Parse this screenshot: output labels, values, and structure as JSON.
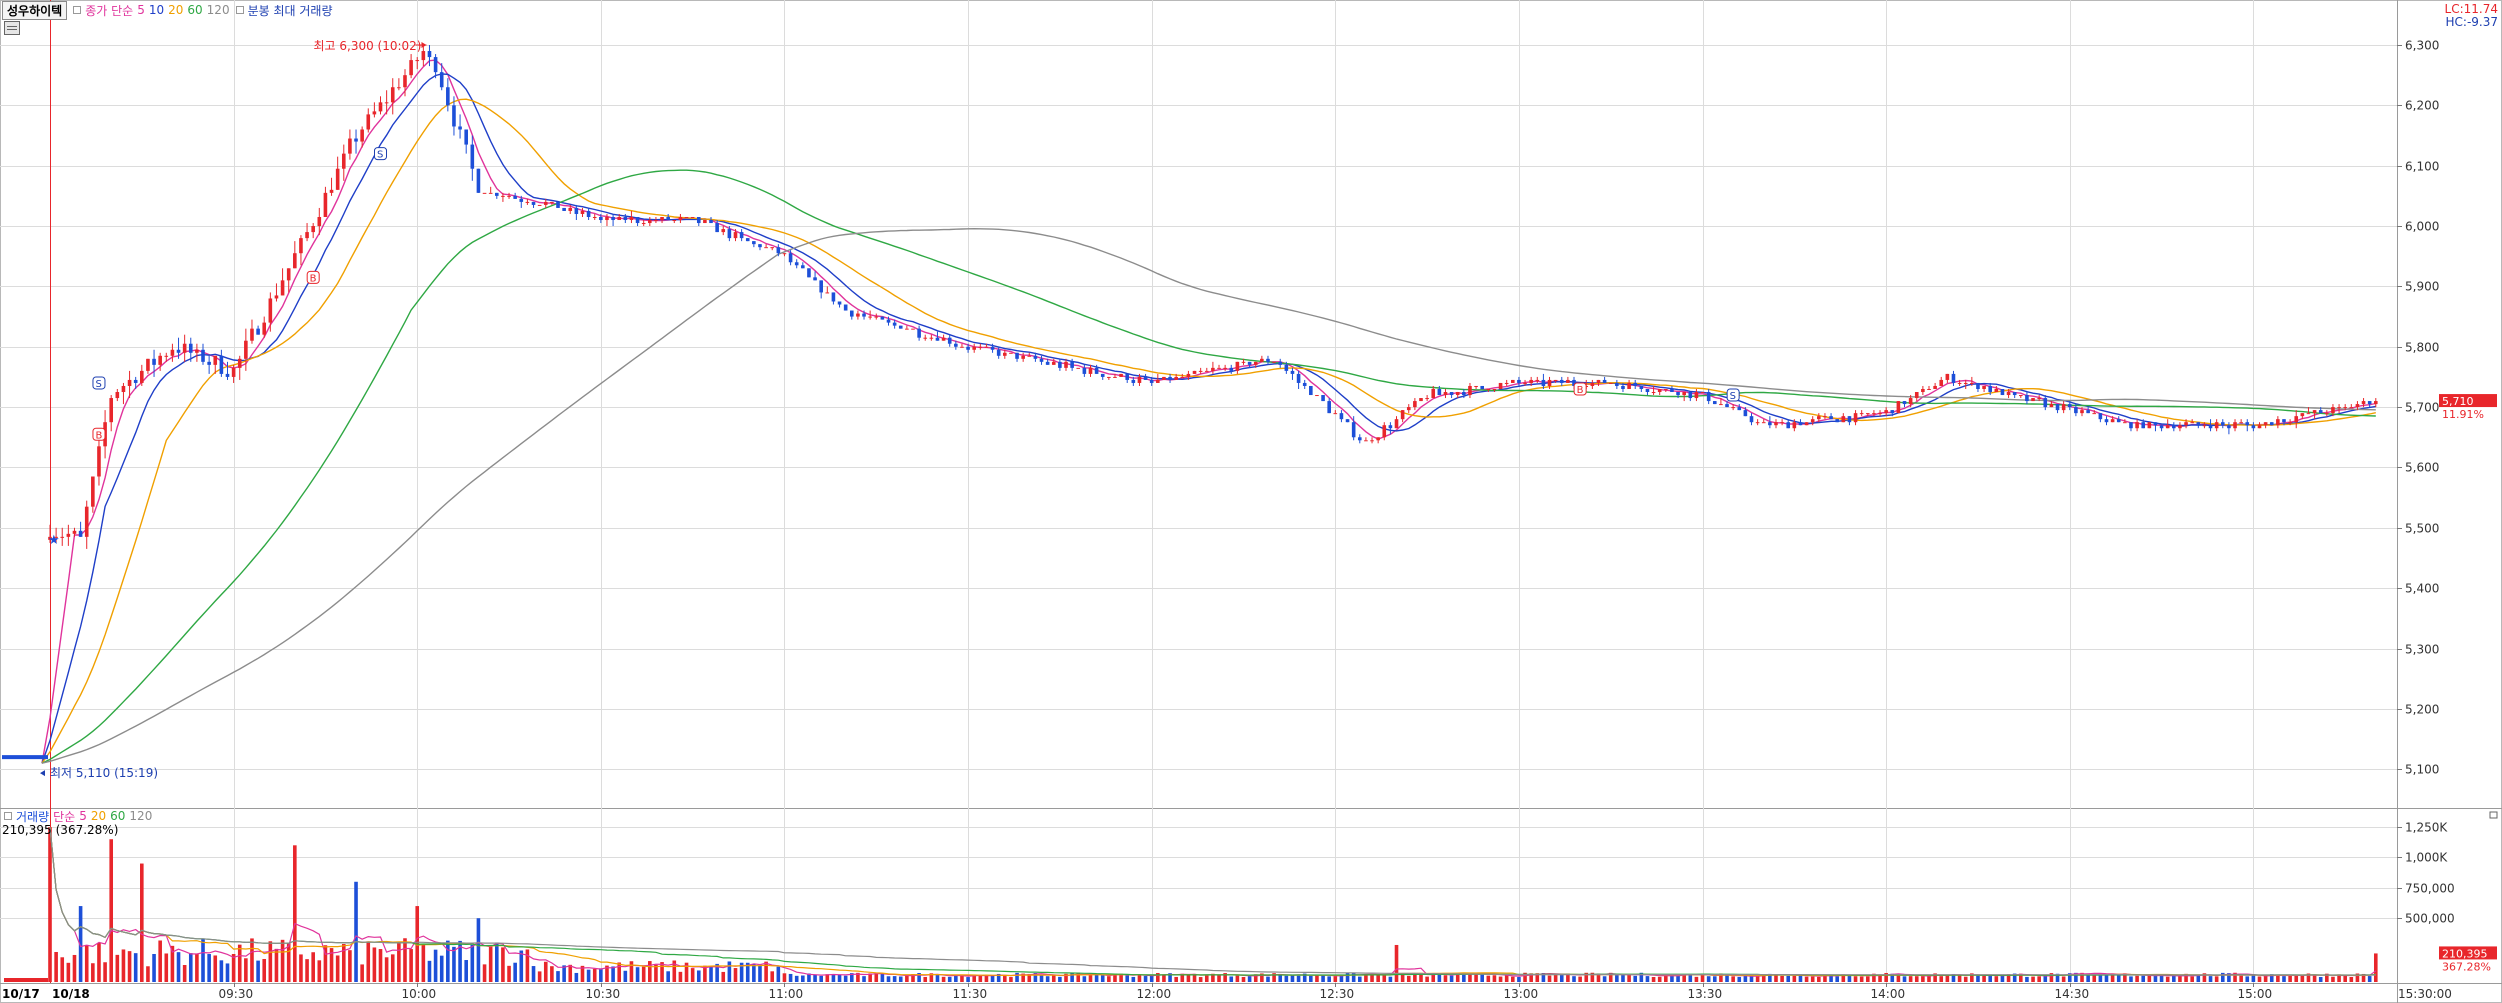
{
  "header": {
    "ticker": "성우하이텍",
    "ma_prefix": "종가 단순",
    "ma_periods": [
      "5",
      "10",
      "20",
      "60",
      "120"
    ],
    "ma_colors": [
      "#e0349c",
      "#1f3fc8",
      "#f0a000",
      "#2fa844",
      "#8c8c8c"
    ],
    "extra_label": "분봉 최대 거래량",
    "lc_label": "LC:11.74",
    "hc_label": "HC:-9.37"
  },
  "volume_legend": {
    "name": "거래량",
    "ma_prefix": "단순",
    "ma_periods": [
      "5",
      "20",
      "60",
      "120"
    ],
    "value_label": "210,395",
    "pct_label": "(367.28%)"
  },
  "annotations": {
    "high_label": "최고 6,300 (10:02)",
    "low_label": "최저 5,110 (15:19)",
    "buy_marks": [
      "B",
      "B"
    ],
    "sell_marks": [
      "S",
      "S",
      "S"
    ],
    "extra_mark": "B"
  },
  "price_badge": {
    "value": "5,710",
    "pct": "11.91%"
  },
  "volume_badge": {
    "value": "210,395",
    "pct": "367.28%"
  },
  "colors": {
    "up": "#e8262b",
    "down": "#1d4fd8",
    "grid": "#dcdcdc",
    "high_text": "#e8262b",
    "low_text": "#1d3fb0"
  },
  "chart_data": {
    "type": "candlestick",
    "x_axis_labels": [
      "10/17",
      "10/18",
      "09:30",
      "10:00",
      "10:30",
      "11:00",
      "11:30",
      "12:00",
      "12:30",
      "13:00",
      "13:30",
      "14:00",
      "14:30",
      "15:00",
      "15:30:00"
    ],
    "price_axis_labels": [
      "6,300",
      "6,200",
      "6,100",
      "6,000",
      "5,900",
      "5,800",
      "5,700",
      "5,600",
      "5,500",
      "5,400",
      "5,300",
      "5,200",
      "5,100"
    ],
    "volume_axis_labels": [
      "1,250K",
      "1,000K",
      "750,000",
      "500,000"
    ],
    "price_range": [
      5060,
      6340
    ],
    "volume_range": [
      0,
      1300000
    ],
    "prev_close": 5110,
    "last_price": 5710,
    "last_volume": 210395,
    "day_high": 6300,
    "day_high_time": "10:02",
    "day_low": 5110,
    "key_points": [
      {
        "t": "09:00",
        "price": 5500
      },
      {
        "t": "09:05",
        "price": 5480
      },
      {
        "t": "09:10",
        "price": 5720
      },
      {
        "t": "09:20",
        "price": 5800
      },
      {
        "t": "09:30",
        "price": 5760
      },
      {
        "t": "09:40",
        "price": 5950
      },
      {
        "t": "09:50",
        "price": 6150
      },
      {
        "t": "10:02",
        "price": 6300
      },
      {
        "t": "10:10",
        "price": 6060
      },
      {
        "t": "10:20",
        "price": 6040
      },
      {
        "t": "10:30",
        "price": 6010
      },
      {
        "t": "10:45",
        "price": 6010
      },
      {
        "t": "11:00",
        "price": 5950
      },
      {
        "t": "11:10",
        "price": 5860
      },
      {
        "t": "11:30",
        "price": 5800
      },
      {
        "t": "12:00",
        "price": 5740
      },
      {
        "t": "12:20",
        "price": 5780
      },
      {
        "t": "12:35",
        "price": 5640
      },
      {
        "t": "12:45",
        "price": 5720
      },
      {
        "t": "13:00",
        "price": 5740
      },
      {
        "t": "13:15",
        "price": 5740
      },
      {
        "t": "13:30",
        "price": 5720
      },
      {
        "t": "13:40",
        "price": 5670
      },
      {
        "t": "14:00",
        "price": 5690
      },
      {
        "t": "14:10",
        "price": 5750
      },
      {
        "t": "14:20",
        "price": 5720
      },
      {
        "t": "14:40",
        "price": 5670
      },
      {
        "t": "15:00",
        "price": 5670
      },
      {
        "t": "15:20",
        "price": 5710
      }
    ],
    "volume_peaks": [
      {
        "t": "09:00",
        "volume": 1250000
      },
      {
        "t": "09:05",
        "volume": 600000
      },
      {
        "t": "09:10",
        "volume": 1150000
      },
      {
        "t": "09:15",
        "volume": 950000
      },
      {
        "t": "09:40",
        "volume": 1100000
      },
      {
        "t": "09:50",
        "volume": 800000
      },
      {
        "t": "10:00",
        "volume": 600000
      },
      {
        "t": "10:10",
        "volume": 500000
      },
      {
        "t": "12:40",
        "volume": 280000
      },
      {
        "t": "15:20",
        "volume": 210395
      }
    ]
  }
}
